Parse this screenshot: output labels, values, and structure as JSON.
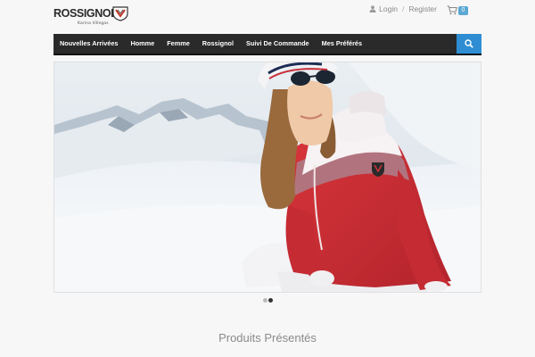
{
  "brand": {
    "name": "ROSSIGNOL",
    "subtitle": "Karina Villegas",
    "badge_color": "#c0392b"
  },
  "account": {
    "login_label": "Login",
    "separator": "/",
    "register_label": "Register",
    "user_icon": "user-icon"
  },
  "cart": {
    "icon": "cart-icon",
    "count": "0",
    "badge_color": "#5aa8d4"
  },
  "nav": {
    "background": "#2a2a2a",
    "items": [
      {
        "label": "Nouvelles Arrivées"
      },
      {
        "label": "Homme"
      },
      {
        "label": "Femme"
      },
      {
        "label": "Rossignol"
      },
      {
        "label": "Suivi De Commande"
      },
      {
        "label": "Mes Préférés"
      }
    ],
    "search_icon": "search-icon",
    "search_color": "#2f8ed3"
  },
  "slider": {
    "slide_count": 2,
    "active_index": 1
  },
  "sections": {
    "featured_title": "Produits Présentés"
  }
}
